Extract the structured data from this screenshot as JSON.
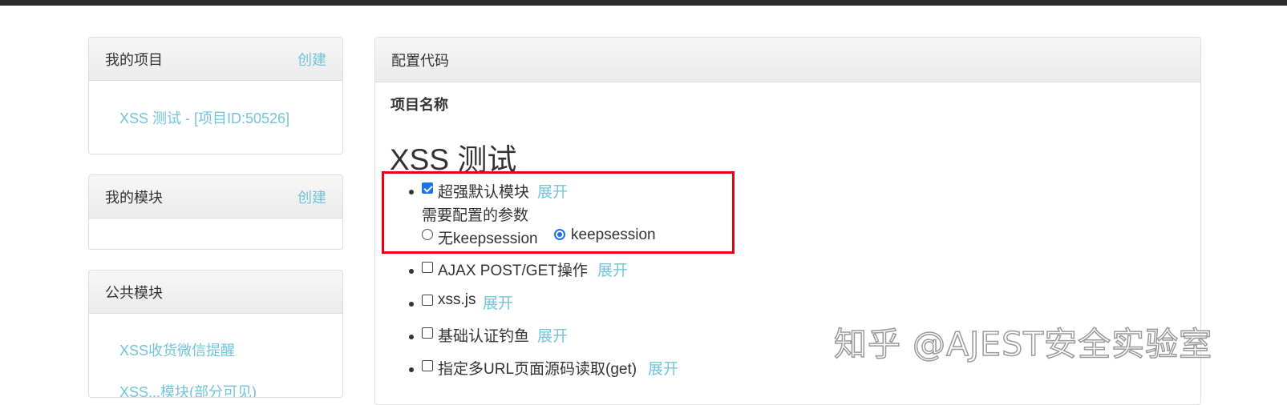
{
  "sidebar": {
    "my_projects": {
      "title": "我的项目",
      "action": "创建",
      "items": [
        "XSS 测试 - [项目ID:50526]"
      ]
    },
    "my_modules": {
      "title": "我的模块",
      "action": "创建"
    },
    "public_modules": {
      "title": "公共模块",
      "items": [
        "XSS收货微信提醒",
        "XSS...模块(部分可见)"
      ]
    }
  },
  "main": {
    "header": "配置代码",
    "field_label": "项目名称",
    "project_name": "XSS 测试",
    "modules": [
      {
        "label": "超强默认模块",
        "expand": "展开",
        "checked": true
      },
      {
        "label": "AJAX POST/GET操作",
        "expand": "展开",
        "checked": false
      },
      {
        "label": "xss.js",
        "expand": "展开",
        "checked": false
      },
      {
        "label": "基础认证钓鱼",
        "expand": "展开",
        "checked": false
      },
      {
        "label": "指定多URL页面源码读取(get)",
        "expand": "展开",
        "checked": false
      }
    ],
    "params": {
      "label": "需要配置的参数",
      "options": [
        "无keepsession",
        "keepsession"
      ],
      "selected": "keepsession"
    }
  },
  "watermark": "知乎 @AJEST安全实验室",
  "colors": {
    "link": "#73c4d9",
    "highlight_box": "#e60012",
    "checkbox_checked": "#1a73e8",
    "topbar": "#2b2b2b"
  }
}
